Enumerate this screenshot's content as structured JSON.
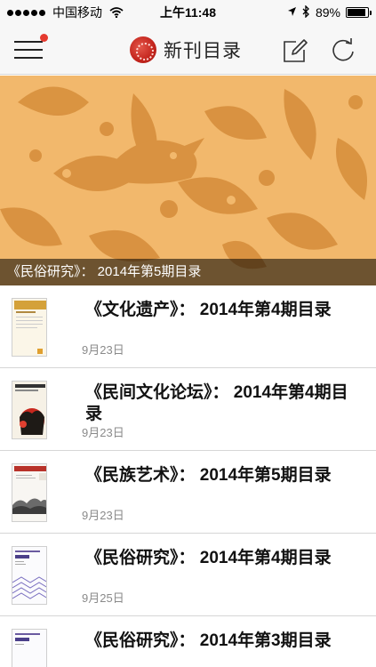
{
  "status_bar": {
    "carrier": "中国移动",
    "time": "上午11:48",
    "battery_percent": "89%",
    "battery_level": 0.89
  },
  "nav": {
    "title": "新刊目录"
  },
  "hero": {
    "caption": "《民俗研究》： 2014年第5期目录"
  },
  "articles": [
    {
      "title": "《文化遗产》： 2014年第4期目录",
      "date": "9月23日",
      "cover": "wenhua-yichan"
    },
    {
      "title": "《民间文化论坛》： 2014年第4期目录",
      "date": "9月23日",
      "cover": "minjian-wenhua"
    },
    {
      "title": "《民族艺术》： 2014年第5期目录",
      "date": "9月23日",
      "cover": "minzu-yishu"
    },
    {
      "title": "《民俗研究》： 2014年第4期目录",
      "date": "9月25日",
      "cover": "minsu-yanjiu"
    },
    {
      "title": "《民俗研究》： 2014年第3期目录",
      "date": "",
      "cover": "minsu-yanjiu"
    }
  ],
  "colors": {
    "hero_background": "#f2b86c",
    "hero_pattern": "#d8913f",
    "notification_dot": "#e53a2f",
    "logo": "#c3241c"
  },
  "icons": [
    "menu-icon",
    "logo-icon",
    "compose-icon",
    "refresh-icon",
    "wifi-icon",
    "location-icon",
    "bluetooth-icon",
    "battery-icon"
  ]
}
